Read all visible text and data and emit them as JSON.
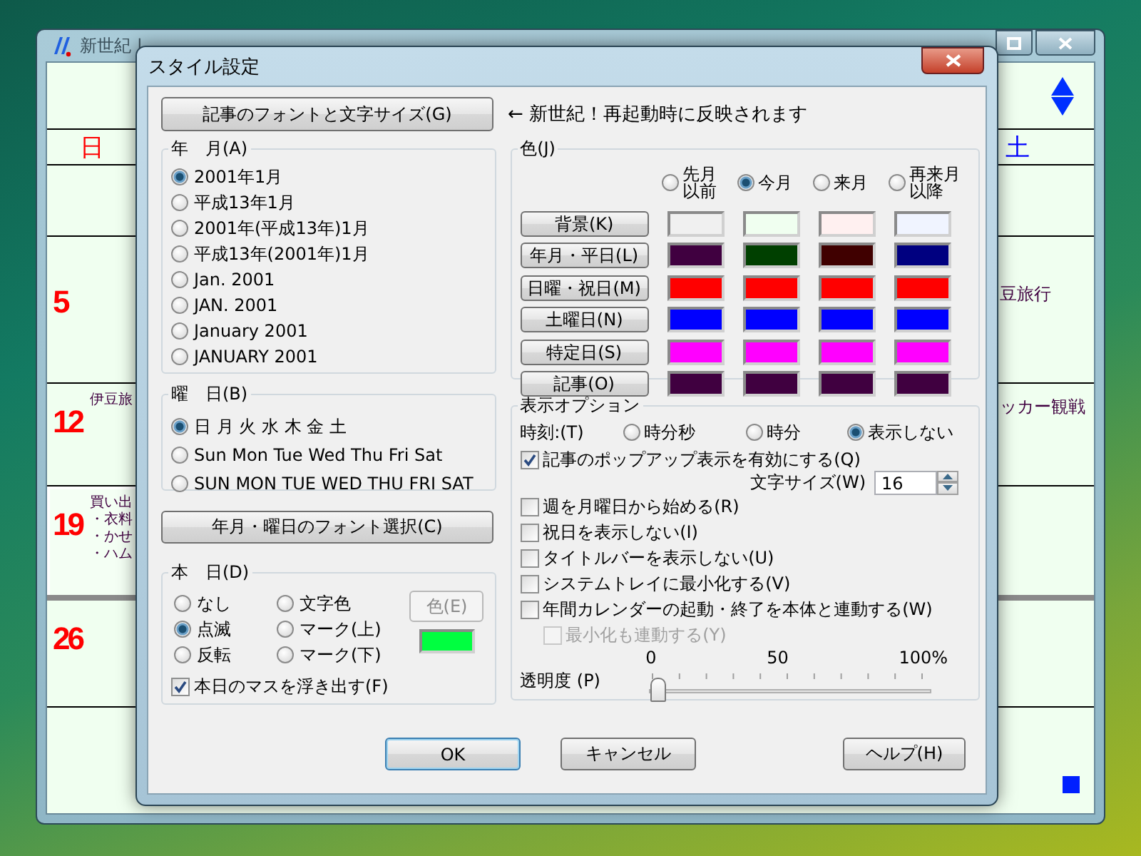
{
  "calendar_window": {
    "title": "新世紀 |",
    "weekdays": [
      {
        "label": "日",
        "kind": "sunday"
      },
      {
        "label": "土",
        "kind": "saturday"
      }
    ],
    "weeks": [
      {
        "day": "5",
        "notes_right": [
          "豆旅行"
        ],
        "today": false
      },
      {
        "day": "12",
        "notes_left": [
          "伊豆旅"
        ],
        "notes_right": [
          "ッカー観戦"
        ],
        "today": false
      },
      {
        "day": "19",
        "notes_left": [
          "買い出",
          "・衣料",
          "・かせ",
          "・ハム"
        ],
        "today": true
      },
      {
        "day": "26",
        "today": false
      }
    ]
  },
  "dialog": {
    "title": "スタイル設定",
    "font_button": "記事のフォントと文字サイズ(G)",
    "restart_note": "← 新世紀！再起動時に反映されます",
    "year_month": {
      "label": "年　月(A)",
      "options": [
        {
          "label": "2001年1月",
          "selected": true
        },
        {
          "label": "平成13年1月",
          "selected": false
        },
        {
          "label": "2001年(平成13年)1月",
          "selected": false
        },
        {
          "label": "平成13年(2001年)1月",
          "selected": false
        },
        {
          "label": "Jan. 2001",
          "selected": false
        },
        {
          "label": "JAN. 2001",
          "selected": false
        },
        {
          "label": "January 2001",
          "selected": false
        },
        {
          "label": "JANUARY 2001",
          "selected": false
        }
      ]
    },
    "weekday": {
      "label": "曜　日(B)",
      "options": [
        {
          "label": "日 月 火 水 木 金 土",
          "selected": true
        },
        {
          "label": "Sun Mon Tue Wed Thu Fri Sat",
          "selected": false
        },
        {
          "label": "SUN MON TUE WED THU FRI SAT",
          "selected": false
        }
      ]
    },
    "weekday_font_button": "年月・曜日のフォント選択(C)",
    "today": {
      "label": "本　日(D)",
      "options": [
        {
          "label": "なし",
          "selected": false
        },
        {
          "label": "点滅",
          "selected": true
        },
        {
          "label": "反転",
          "selected": false
        },
        {
          "label": "文字色",
          "selected": false
        },
        {
          "label": "マーク(上)",
          "selected": false
        },
        {
          "label": "マーク(下)",
          "selected": false
        }
      ],
      "color_button": {
        "label": "色(E)",
        "disabled": true
      },
      "color": "#00ff40",
      "raised": {
        "label": "本日のマスを浮き出す(F)",
        "checked": true
      }
    },
    "colors": {
      "label": "色(J)",
      "periods": [
        {
          "lines": [
            "先月",
            "以前"
          ],
          "selected": false
        },
        {
          "lines": [
            "今月"
          ],
          "selected": true
        },
        {
          "lines": [
            "来月"
          ],
          "selected": false
        },
        {
          "lines": [
            "再来月",
            "以降"
          ],
          "selected": false
        }
      ],
      "rows": [
        {
          "label": "背景(K)",
          "swatches": [
            {
              "color": "#f0f0f0"
            },
            {
              "color": "#f0fff0"
            },
            {
              "color": "#fff0f0"
            },
            {
              "color": "#f0f4ff"
            }
          ]
        },
        {
          "label": "年月・平日(L)",
          "swatches": [
            {
              "color": "#400040"
            },
            {
              "color": "#004000"
            },
            {
              "color": "#400000"
            },
            {
              "color": "#000080"
            }
          ]
        },
        {
          "label": "日曜・祝日(M)",
          "swatches": [
            {
              "color": "#ff0000"
            },
            {
              "color": "#ff0000"
            },
            {
              "color": "#ff0000"
            },
            {
              "color": "#ff0000"
            }
          ]
        },
        {
          "label": "土曜日(N)",
          "swatches": [
            {
              "color": "#0000ff"
            },
            {
              "color": "#0000ff"
            },
            {
              "color": "#0000ff"
            },
            {
              "color": "#0000ff"
            }
          ]
        },
        {
          "label": "特定日(S)",
          "swatches": [
            {
              "color": "#ff00ff"
            },
            {
              "color": "#ff00ff"
            },
            {
              "color": "#ff00ff"
            },
            {
              "color": "#ff00ff"
            }
          ]
        },
        {
          "label": "記事(O)",
          "swatches": [
            {
              "color": "#400040"
            },
            {
              "color": "#400040"
            },
            {
              "color": "#400040"
            },
            {
              "color": "#400040"
            }
          ]
        }
      ]
    },
    "display": {
      "label": "表示オプション",
      "time": {
        "label": "時刻:(T)",
        "options": [
          {
            "label": "時分秒",
            "selected": false
          },
          {
            "label": "時分",
            "selected": false
          },
          {
            "label": "表示しない",
            "selected": true
          }
        ]
      },
      "options": [
        {
          "kind": "checkbox",
          "label": "記事のポップアップ表示を有効にする(Q)",
          "checked": true,
          "disabled": false
        },
        {
          "kind": "spin",
          "label": "文字サイズ(W)",
          "value": "16"
        },
        {
          "kind": "checkbox",
          "label": "週を月曜日から始める(R)",
          "checked": false,
          "disabled": false
        },
        {
          "kind": "checkbox",
          "label": "祝日を表示しない(I)",
          "checked": false,
          "disabled": false
        },
        {
          "kind": "checkbox",
          "label": "タイトルバーを表示しない(U)",
          "checked": false,
          "disabled": false
        },
        {
          "kind": "checkbox",
          "label": "システムトレイに最小化する(V)",
          "checked": false,
          "disabled": false
        },
        {
          "kind": "checkbox",
          "label": "年間カレンダーの起動・終了を本体と連動する(W)",
          "checked": false,
          "disabled": false,
          "children": [
            {
              "kind": "checkbox",
              "label": "最小化も連動する(Y)",
              "checked": false,
              "disabled": true
            }
          ]
        }
      ],
      "transparency": {
        "label": "透明度 (P)",
        "ticks": [
          "0",
          "50",
          "100%"
        ],
        "level": 0
      }
    },
    "buttons": [
      {
        "label": "OK",
        "default": true
      },
      {
        "label": "キャンセル",
        "default": false
      },
      {
        "label": "ヘルプ(H)",
        "default": false
      }
    ]
  }
}
